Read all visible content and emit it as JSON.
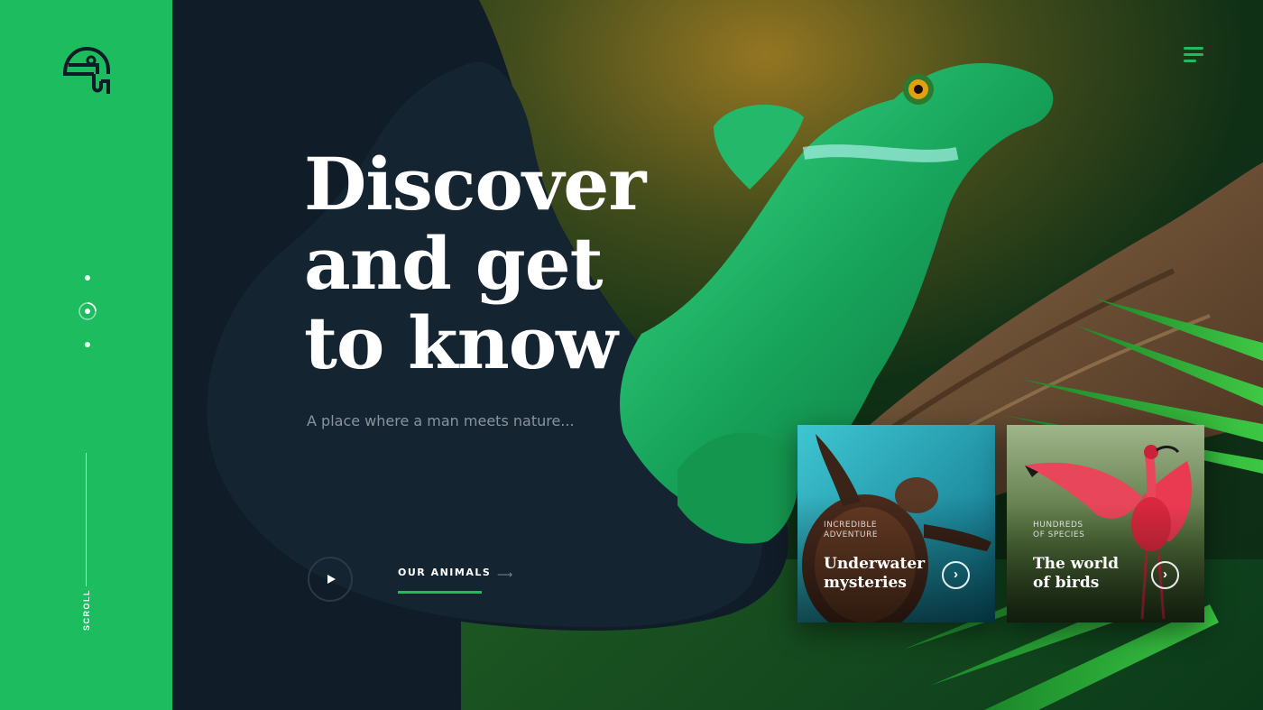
{
  "brand": {
    "logo_icon": "toucan-logo-icon",
    "accent": "#1dbd5f"
  },
  "sidebar": {
    "scroll_label": "SCROLL",
    "slides": 3,
    "active_slide": 2
  },
  "header": {
    "menu_icon": "hamburger-menu-icon"
  },
  "hero": {
    "headline_lines": [
      "Discover",
      "and get",
      "to know"
    ],
    "tagline": "A place where a man meets nature...",
    "cta_label": "OUR ANIMALS",
    "play_icon": "play-icon",
    "arrow_icon": "arrow-right-icon"
  },
  "cards": [
    {
      "kicker": "INCREDIBLE ADVENTURE",
      "kicker_lines": [
        "INCREDIBLE",
        "ADVENTURE"
      ],
      "title_lines": [
        "Underwater",
        "mysteries"
      ],
      "arrow": "›"
    },
    {
      "kicker": "HUNDREDS OF SPECIES",
      "kicker_lines": [
        "HUNDREDS",
        "OF SPECIES"
      ],
      "title_lines": [
        "The world",
        "of birds"
      ],
      "arrow": "›"
    }
  ]
}
